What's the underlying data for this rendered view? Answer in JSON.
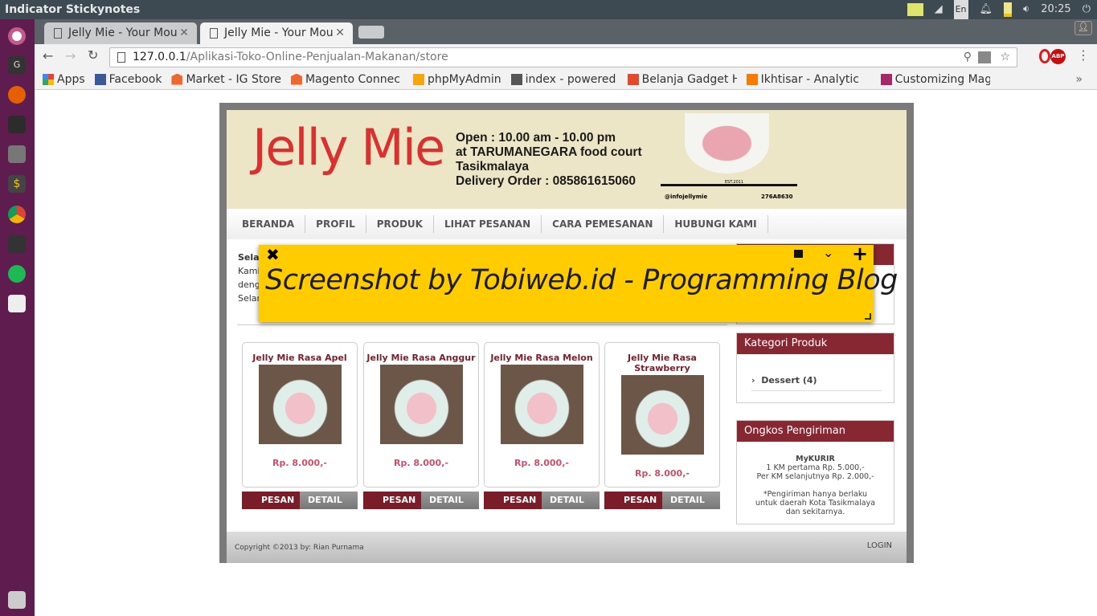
{
  "panel": {
    "title": "Indicator Stickynotes",
    "clock": "20:25",
    "keyboard": "En"
  },
  "launcher": {
    "items": [
      "ubuntu-dash",
      "gnome-app",
      "firefox",
      "terminal",
      "files",
      "dollar-app",
      "chrome",
      "cat-app",
      "spotify",
      "text-editor",
      "trash"
    ]
  },
  "browser": {
    "tabs": [
      {
        "label": "Jelly Mie - Your Mou"
      },
      {
        "label": "Jelly Mie - Your Mou"
      }
    ],
    "url_host": "127.0.0.1",
    "url_path": "/Aplikasi-Toko-Online-Penjualan-Makanan/store",
    "bookmarks": [
      {
        "label": "Apps"
      },
      {
        "label": "Facebook"
      },
      {
        "label": "Market - IG Store"
      },
      {
        "label": "Magento Connec"
      },
      {
        "label": "phpMyAdmin"
      },
      {
        "label": "index - powered b"
      },
      {
        "label": "Belanja Gadget H"
      },
      {
        "label": "Ikhtisar - Analytic"
      },
      {
        "label": "Customizing Mag"
      }
    ],
    "abp": "ABP"
  },
  "site": {
    "banner": {
      "logo": "Jelly Mie",
      "open": "Open : 10.00 am - 10.00 pm",
      "place": "at TARUMANEGARA food court",
      "city": "Tasikmalaya",
      "delivery": "Delivery Order : 085861615060",
      "est": "EST.2011",
      "twitter": "@infojellymie",
      "pin": "276A8630"
    },
    "nav": [
      "BERANDA",
      "PROFIL",
      "PRODUK",
      "LIHAT PESANAN",
      "CARA PEMESANAN",
      "HUBUNGI KAMI"
    ],
    "intro": {
      "title": "Selar",
      "lines": [
        "Kami",
        "deng",
        "Selar"
      ]
    },
    "products": [
      {
        "name": "Jelly Mie Rasa Apel",
        "price": "Rp. 8.000,-"
      },
      {
        "name": "Jelly Mie Rasa Anggur",
        "price": "Rp. 8.000,-"
      },
      {
        "name": "Jelly Mie Rasa Melon",
        "price": "Rp. 8.000,-"
      },
      {
        "name": "Jelly Mie Rasa Strawberry",
        "price": "Rp. 8.000,-"
      }
    ],
    "buttons": {
      "order": "PESAN",
      "detail": "DETAIL"
    },
    "categories": {
      "title": "Kategori Produk",
      "items": [
        "Dessert (4)"
      ]
    },
    "shipping": {
      "title": "Ongkos Pengiriman",
      "courier": "MyKURIR",
      "line1": "1 KM pertama Rp. 5.000,-",
      "line2": "Per KM selanjutnya Rp. 2.000,-",
      "note": "*Pengiriman hanya berlaku untuk daerah Kota Tasikmalaya dan sekitarnya."
    },
    "footer": {
      "copyright": "Copyright ©2013 by: Rian Purnama",
      "login": "LOGIN"
    }
  },
  "sticky": {
    "text": "Screenshot by Tobiweb.id - Programming Blog",
    "color": "#ffcc00"
  }
}
